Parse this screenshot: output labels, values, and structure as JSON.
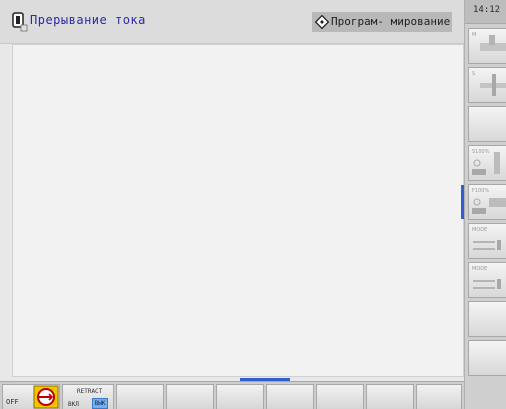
{
  "header": {
    "mode_title": "Прерывание тока",
    "program_mode": "Програм- мирование",
    "mode_icon": "power-plug-icon",
    "program_icon": "programming-diamond-icon"
  },
  "clock": {
    "time": "14:12"
  },
  "sidebar": {
    "buttons": [
      {
        "label": "M",
        "icon": "spindle-m-icon"
      },
      {
        "label": "S",
        "icon": "spindle-s-icon"
      },
      {
        "label": "",
        "icon": "blank-icon"
      },
      {
        "label": "S100%",
        "icon": "spindle-override-icon"
      },
      {
        "label": "F100%",
        "icon": "feed-override-icon"
      },
      {
        "label": "MODE",
        "icon": "mode-icon"
      },
      {
        "label": "MODE",
        "icon": "mode-icon"
      },
      {
        "label": "",
        "icon": "blank-icon"
      },
      {
        "label": "",
        "icon": "blank-icon"
      }
    ]
  },
  "softkeys": {
    "off_label": "OFF",
    "retract_label": "RETRACT",
    "on_label": "ВКЛ",
    "off_btn_label": "ВЫК"
  },
  "colors": {
    "accent": "#2f5fd0",
    "title": "#2a2aaa"
  }
}
